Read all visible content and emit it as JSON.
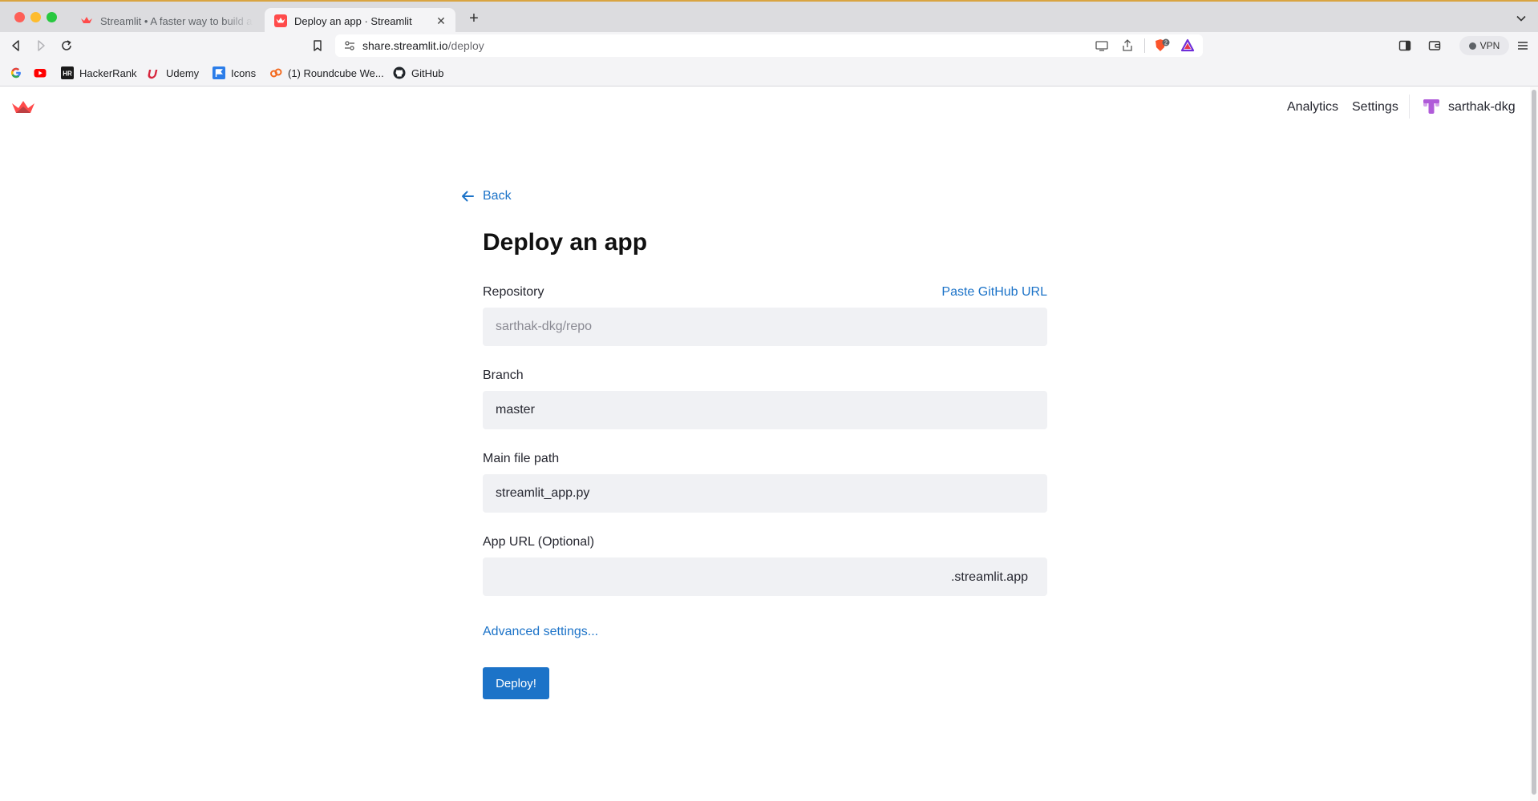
{
  "browser": {
    "tabs": [
      {
        "title": "Streamlit • A faster way to build and share data apps",
        "active": false
      },
      {
        "title": "Deploy an app · Streamlit",
        "active": true
      }
    ],
    "url_host": "share.streamlit.io",
    "url_path": "/deploy",
    "vpn_label": "VPN",
    "brave_badge_count": "2",
    "bookmarks": [
      {
        "label": "",
        "icon": "google-icon"
      },
      {
        "label": "",
        "icon": "youtube-icon"
      },
      {
        "label": "HackerRank",
        "icon": "hackerrank-icon"
      },
      {
        "label": "Udemy",
        "icon": "udemy-icon"
      },
      {
        "label": "Icons",
        "icon": "icons-icon"
      },
      {
        "label": "(1) Roundcube We...",
        "icon": "roundcube-icon"
      },
      {
        "label": "GitHub",
        "icon": "github-icon"
      }
    ]
  },
  "header": {
    "analytics": "Analytics",
    "settings": "Settings",
    "username": "sarthak-dkg"
  },
  "form": {
    "back": "Back",
    "title": "Deploy an app",
    "repository_label": "Repository",
    "paste_github_url": "Paste GitHub URL",
    "repository_placeholder": "sarthak-dkg/repo",
    "branch_label": "Branch",
    "branch_value": "master",
    "main_file_label": "Main file path",
    "main_file_value": "streamlit_app.py",
    "app_url_label": "App URL (Optional)",
    "app_url_value": "",
    "app_url_suffix": ".streamlit.app",
    "advanced_settings": "Advanced settings...",
    "deploy_button": "Deploy!"
  },
  "colors": {
    "accent": "#1c73c8",
    "field_bg": "#f0f1f4",
    "streamlit_red": "#ff4b4b"
  }
}
